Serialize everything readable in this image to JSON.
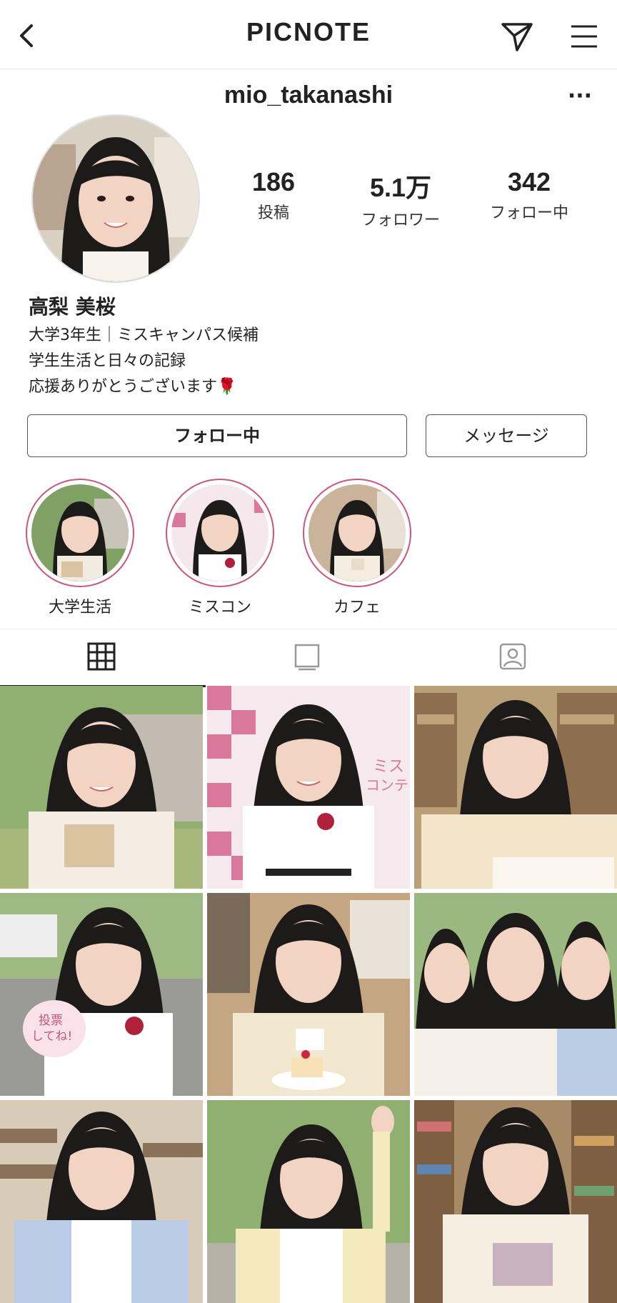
{
  "header": {
    "title": "PICNOTE"
  },
  "profile": {
    "username": "mio_takanashi",
    "display_name": "高梨 美桜",
    "bio": [
      "大学3年生｜ミスキャンパス候補",
      "学生生活と日々の記録",
      "応援ありがとうございます🌹"
    ],
    "stats": [
      {
        "value": "186",
        "label": "投稿"
      },
      {
        "value": "5.1万",
        "label": "フォロワー"
      },
      {
        "value": "342",
        "label": "フォロー中"
      }
    ]
  },
  "buttons": {
    "follow": "フォロー中",
    "message": "メッセージ"
  },
  "highlights": [
    {
      "label": "大学生活"
    },
    {
      "label": "ミスコン"
    },
    {
      "label": "カフェ"
    }
  ],
  "tabs": [
    {
      "icon": "grid-icon",
      "active": true
    },
    {
      "icon": "reels-icon",
      "active": false
    },
    {
      "icon": "tagged-icon",
      "active": false
    }
  ],
  "posts": [
    {
      "scene": "campus-outdoor"
    },
    {
      "scene": "miss-contest-backdrop",
      "backdrop_text": "ミス\nコンテ"
    },
    {
      "scene": "library-study"
    },
    {
      "scene": "campus-festival",
      "sign_text": "投票\nしてね!"
    },
    {
      "scene": "cafe-cake"
    },
    {
      "scene": "three-friends"
    },
    {
      "scene": "classroom"
    },
    {
      "scene": "park-wave"
    },
    {
      "scene": "bookstore"
    }
  ],
  "colors": {
    "accent_ring": "#c8567d",
    "text": "#222222"
  }
}
